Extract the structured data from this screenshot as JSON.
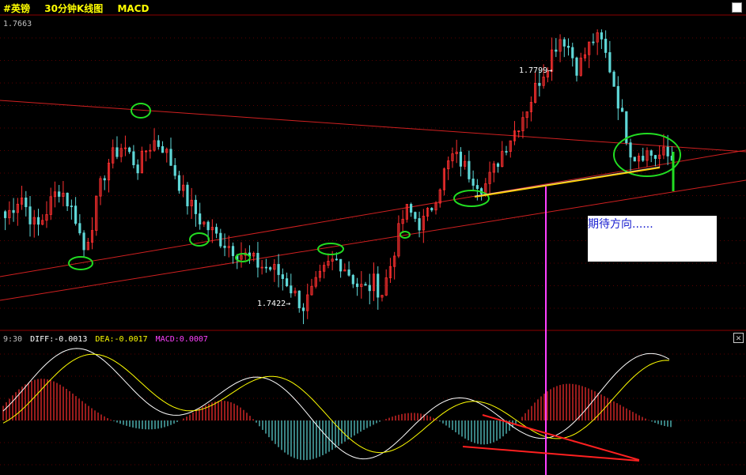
{
  "header": {
    "symbol": "#英镑",
    "period": "30分钟K线图",
    "indicator": "MACD"
  },
  "price_axis": {
    "top_value": "1.7663"
  },
  "annotations": {
    "high_label": "1.7799→",
    "low_label": "1.7422→",
    "note_text": "期待方向......"
  },
  "macd_info": {
    "time": "9:30",
    "diff": "DIFF:-0.0013",
    "dea": "DEA:-0.0017",
    "macd": "MACD:0.0007"
  },
  "colors": {
    "background": "#000000",
    "bull": "#ff3030",
    "bear": "#5fd7d7",
    "trendline": "#d02020",
    "circle": "#22dd22",
    "diff_line": "#ffffff",
    "dea_line": "#ffff00",
    "support": "#ffcc00",
    "vertical_marker": "#ff40ff",
    "header_text": "#ffff00",
    "macd_label": "#ff40ff"
  },
  "icons": {
    "close": "close-icon"
  },
  "chart_data": {
    "type": "candlestick",
    "title": "30分钟K线图",
    "ylim": [
      1.74,
      1.781
    ],
    "price_high": 1.7799,
    "price_low": 1.7422,
    "price_path": [
      1.7545,
      1.756,
      1.7575,
      1.755,
      1.753,
      1.7548,
      1.757,
      1.7585,
      1.7565,
      1.7545,
      1.7502,
      1.7535,
      1.758,
      1.7615,
      1.763,
      1.764,
      1.7625,
      1.761,
      1.7635,
      1.7645,
      1.764,
      1.762,
      1.7595,
      1.757,
      1.7555,
      1.754,
      1.753,
      1.752,
      1.7512,
      1.7505,
      1.7498,
      1.7492,
      1.7485,
      1.748,
      1.7478,
      1.747,
      1.746,
      1.7442,
      1.7428,
      1.7445,
      1.7462,
      1.748,
      1.749,
      1.7485,
      1.747,
      1.7455,
      1.745,
      1.746,
      1.7445,
      1.7478,
      1.752,
      1.7555,
      1.7548,
      1.7535,
      1.755,
      1.7578,
      1.7605,
      1.7625,
      1.762,
      1.7605,
      1.7595,
      1.7585,
      1.76,
      1.7625,
      1.7645,
      1.766,
      1.768,
      1.77,
      1.7725,
      1.7745,
      1.777,
      1.7785,
      1.7765,
      1.774,
      1.7762,
      1.778,
      1.7775,
      1.7745,
      1.7705,
      1.766,
      1.7625,
      1.7632,
      1.763,
      1.7625,
      1.7628,
      1.7622
    ],
    "macd": {
      "diff_last": -0.0013,
      "dea_last": -0.0017,
      "macd_last": 0.0007
    }
  }
}
